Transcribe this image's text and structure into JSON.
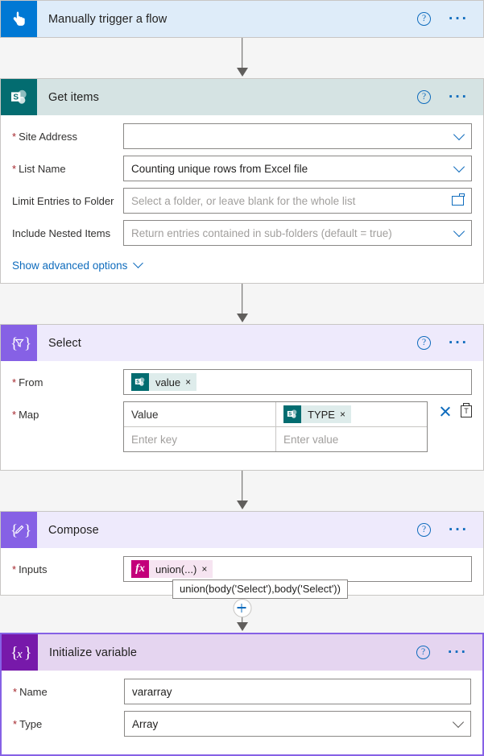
{
  "steps": {
    "trigger": {
      "title": "Manually trigger a flow",
      "icon": "touch-trigger-icon",
      "icon_bg": "#0078d4",
      "header_bg": "#deecf9"
    },
    "get_items": {
      "title": "Get items",
      "icon": "sharepoint-icon",
      "icon_bg": "#036c70",
      "header_bg": "#d5e3e3",
      "fields": [
        {
          "label": "Site Address",
          "required": true,
          "value": "",
          "placeholder": "",
          "control": "dropdown"
        },
        {
          "label": "List Name",
          "required": true,
          "value": "Counting unique rows from Excel file",
          "placeholder": "",
          "control": "dropdown"
        },
        {
          "label": "Limit Entries to Folder",
          "required": false,
          "value": "",
          "placeholder": "Select a folder, or leave blank for the whole list",
          "control": "folder"
        },
        {
          "label": "Include Nested Items",
          "required": false,
          "value": "",
          "placeholder": "Return entries contained in sub-folders (default = true)",
          "control": "dropdown"
        }
      ],
      "advanced_label": "Show advanced options"
    },
    "select": {
      "title": "Select",
      "icon": "select-braces-icon",
      "icon_bg": "#8661e5",
      "header_bg": "#eeeafc",
      "from_label": "From",
      "from_token": {
        "text": "value",
        "icon": "sharepoint-icon",
        "remove": "×"
      },
      "map_label": "Map",
      "map_rows": [
        {
          "key": "Value",
          "key_placeholder": "",
          "value_token": {
            "text": "TYPE",
            "icon": "sharepoint-icon",
            "remove": "×"
          },
          "value_placeholder": ""
        },
        {
          "key": "",
          "key_placeholder": "Enter key",
          "value_token": null,
          "value_placeholder": "Enter value"
        }
      ]
    },
    "compose": {
      "title": "Compose",
      "icon": "compose-pencil-icon",
      "icon_bg": "#8661e5",
      "header_bg": "#eeeafc",
      "inputs_label": "Inputs",
      "inputs_token": {
        "text": "union(...)",
        "icon": "fx-icon",
        "remove": "×"
      },
      "tooltip": "union(body('Select'),body('Select'))"
    },
    "init_variable": {
      "title": "Initialize variable",
      "icon": "variable-braces-icon",
      "icon_bg": "#7719aa",
      "header_bg": "#e5d5f0",
      "selected": true,
      "fields": [
        {
          "label": "Name",
          "required": true,
          "value": "vararray",
          "placeholder": "",
          "control": "text"
        },
        {
          "label": "Type",
          "required": true,
          "value": "Array",
          "placeholder": "",
          "control": "dropdown-gray"
        }
      ]
    }
  },
  "common": {
    "help_glyph": "?",
    "ellipsis_glyph": "···",
    "required_mark": "*",
    "add_step_label": "+"
  }
}
